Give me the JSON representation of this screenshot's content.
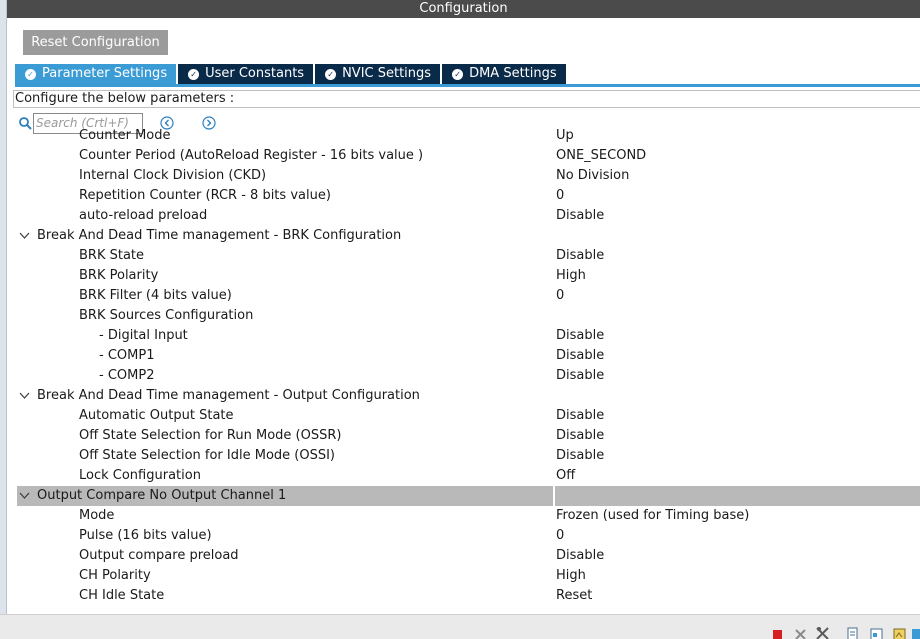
{
  "window": {
    "title": "Configuration"
  },
  "toolbar": {
    "reset_label": "Reset Configuration"
  },
  "tabs": [
    {
      "label": "Parameter Settings",
      "active": true
    },
    {
      "label": "User Constants",
      "active": false
    },
    {
      "label": "NVIC Settings",
      "active": false
    },
    {
      "label": "DMA Settings",
      "active": false
    }
  ],
  "configure_label": "Configure the below parameters :",
  "search": {
    "placeholder": "Search (Crtl+F)"
  },
  "params": [
    {
      "kind": "item",
      "name": "Counter Mode",
      "value": "Up"
    },
    {
      "kind": "item",
      "name": "Counter Period (AutoReload Register - 16 bits value )",
      "value": "ONE_SECOND"
    },
    {
      "kind": "item",
      "name": "Internal Clock Division (CKD)",
      "value": "No Division"
    },
    {
      "kind": "item",
      "name": "Repetition Counter (RCR - 8 bits value)",
      "value": "0"
    },
    {
      "kind": "item",
      "name": "auto-reload preload",
      "value": "Disable"
    },
    {
      "kind": "group",
      "name": "Break And Dead Time management - BRK Configuration",
      "value": ""
    },
    {
      "kind": "item",
      "name": "BRK State",
      "value": "Disable"
    },
    {
      "kind": "item",
      "name": "BRK Polarity",
      "value": "High"
    },
    {
      "kind": "item",
      "name": "BRK Filter (4 bits value)",
      "value": "0"
    },
    {
      "kind": "item",
      "name": "BRK Sources Configuration",
      "value": ""
    },
    {
      "kind": "sub",
      "name": "- Digital Input",
      "value": "Disable"
    },
    {
      "kind": "sub",
      "name": "- COMP1",
      "value": "Disable"
    },
    {
      "kind": "sub",
      "name": "- COMP2",
      "value": "Disable"
    },
    {
      "kind": "group",
      "name": "Break And Dead Time management - Output Configuration",
      "value": ""
    },
    {
      "kind": "item",
      "name": "Automatic Output State",
      "value": "Disable"
    },
    {
      "kind": "item",
      "name": "Off State Selection for Run Mode (OSSR)",
      "value": "Disable"
    },
    {
      "kind": "item",
      "name": "Off State Selection for Idle Mode (OSSI)",
      "value": "Disable"
    },
    {
      "kind": "item",
      "name": "Lock Configuration",
      "value": "Off"
    },
    {
      "kind": "group",
      "name": "Output Compare No Output Channel 1",
      "value": "",
      "selected": true
    },
    {
      "kind": "item",
      "name": "Mode",
      "value": "Frozen (used for Timing base)"
    },
    {
      "kind": "item",
      "name": "Pulse (16 bits value)",
      "value": "0"
    },
    {
      "kind": "item",
      "name": "Output compare preload",
      "value": "Disable"
    },
    {
      "kind": "item",
      "name": "CH Polarity",
      "value": "High"
    },
    {
      "kind": "item",
      "name": "CH Idle State",
      "value": "Reset"
    }
  ],
  "status_icons": [
    "stop-icon",
    "close-icon",
    "tools-icon",
    "page-icon",
    "export-icon",
    "image-icon",
    "scroll-icon"
  ],
  "colors": {
    "title_bar": "#4b4b4b",
    "tab_active": "#3b9bd4",
    "tab_inactive": "#0a2a4a",
    "reset_button": "#9b9b9b",
    "selected_row": "#b9b9b9"
  }
}
